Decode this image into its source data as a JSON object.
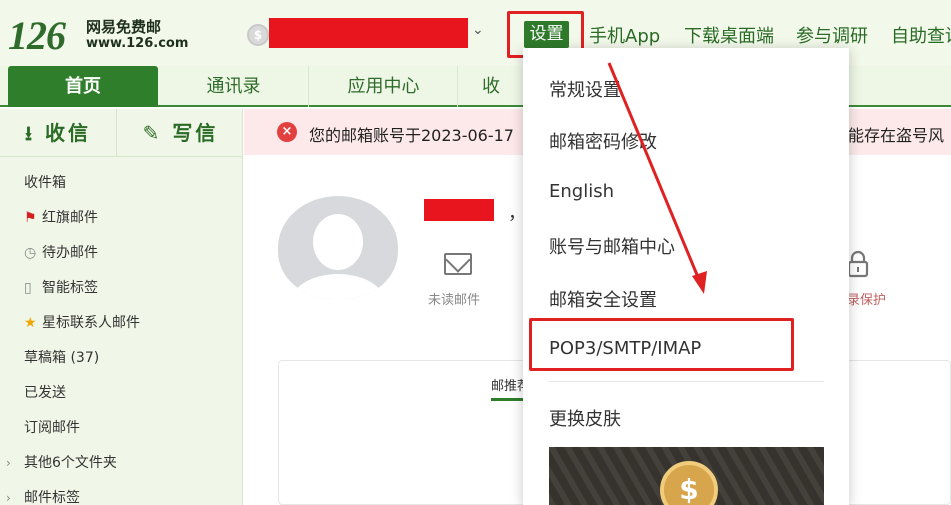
{
  "header": {
    "logo_number": "126",
    "logo_name": "网易免费邮",
    "logo_url": "www.126.com",
    "settings_label": "设置",
    "nav": [
      "手机App",
      "下载桌面端",
      "参与调研",
      "自助查询"
    ]
  },
  "tabs": [
    "首页",
    "通讯录",
    "应用中心",
    "收"
  ],
  "sidebar": {
    "receive_label": "收信",
    "write_label": "写信",
    "folders": [
      {
        "label": "收件箱",
        "icon": ""
      },
      {
        "label": "红旗邮件",
        "icon": "red-flag-icon"
      },
      {
        "label": "待办邮件",
        "icon": "clock-icon"
      },
      {
        "label": "智能标签",
        "icon": "tag-icon"
      },
      {
        "label": "星标联系人邮件",
        "icon": "star-icon"
      },
      {
        "label": "草稿箱 (37)",
        "icon": ""
      },
      {
        "label": "已发送",
        "icon": ""
      },
      {
        "label": "订阅邮件",
        "icon": ""
      },
      {
        "label": "其他6个文件夹",
        "icon": "chevron-right-icon"
      },
      {
        "label": "邮件标签",
        "icon": "chevron-right-icon"
      }
    ]
  },
  "alert": {
    "text_left": "您的邮箱账号于2023-06-17",
    "text_right": "能存在盗号风"
  },
  "main": {
    "name_suffix": "，有",
    "unread_label": "未读邮件",
    "protect_label": "录保护",
    "card_tab_label": "邮推荐"
  },
  "dropdown": {
    "items": [
      "常规设置",
      "邮箱密码修改",
      "English",
      "账号与邮箱中心",
      "邮箱安全设置",
      "POP3/SMTP/IMAP",
      "更换皮肤"
    ]
  },
  "colors": {
    "brand_green": "#2f7e2b",
    "highlight_red": "#e02121",
    "redaction_red": "#e8141e"
  }
}
